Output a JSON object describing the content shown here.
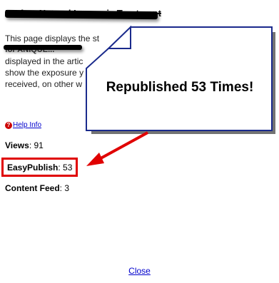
{
  "article": {
    "title": "Perfect Natural Insomnia Treatment",
    "description_lines": [
      "This page displays the st",
      "for ANIQUE...",
      "displayed in the artic",
      "show the exposure y",
      "received, on other w"
    ]
  },
  "help": {
    "icon": "question-icon",
    "label": "Help Info"
  },
  "stats": {
    "views_label": "Views",
    "views_value": ": 91",
    "easypublish_label": "EasyPublish",
    "easypublish_value": ": 53",
    "content_feed_label": "Content Feed",
    "content_feed_value": ": 3"
  },
  "callout": {
    "text": "Republished 53 Times!"
  },
  "footer": {
    "close_label": "Close"
  },
  "colors": {
    "callout_fill": "#ffffff",
    "callout_border": "#1a2a8c",
    "callout_shadow": "#000000",
    "highlight_red": "#e00000",
    "link_blue": "#0000cc"
  }
}
